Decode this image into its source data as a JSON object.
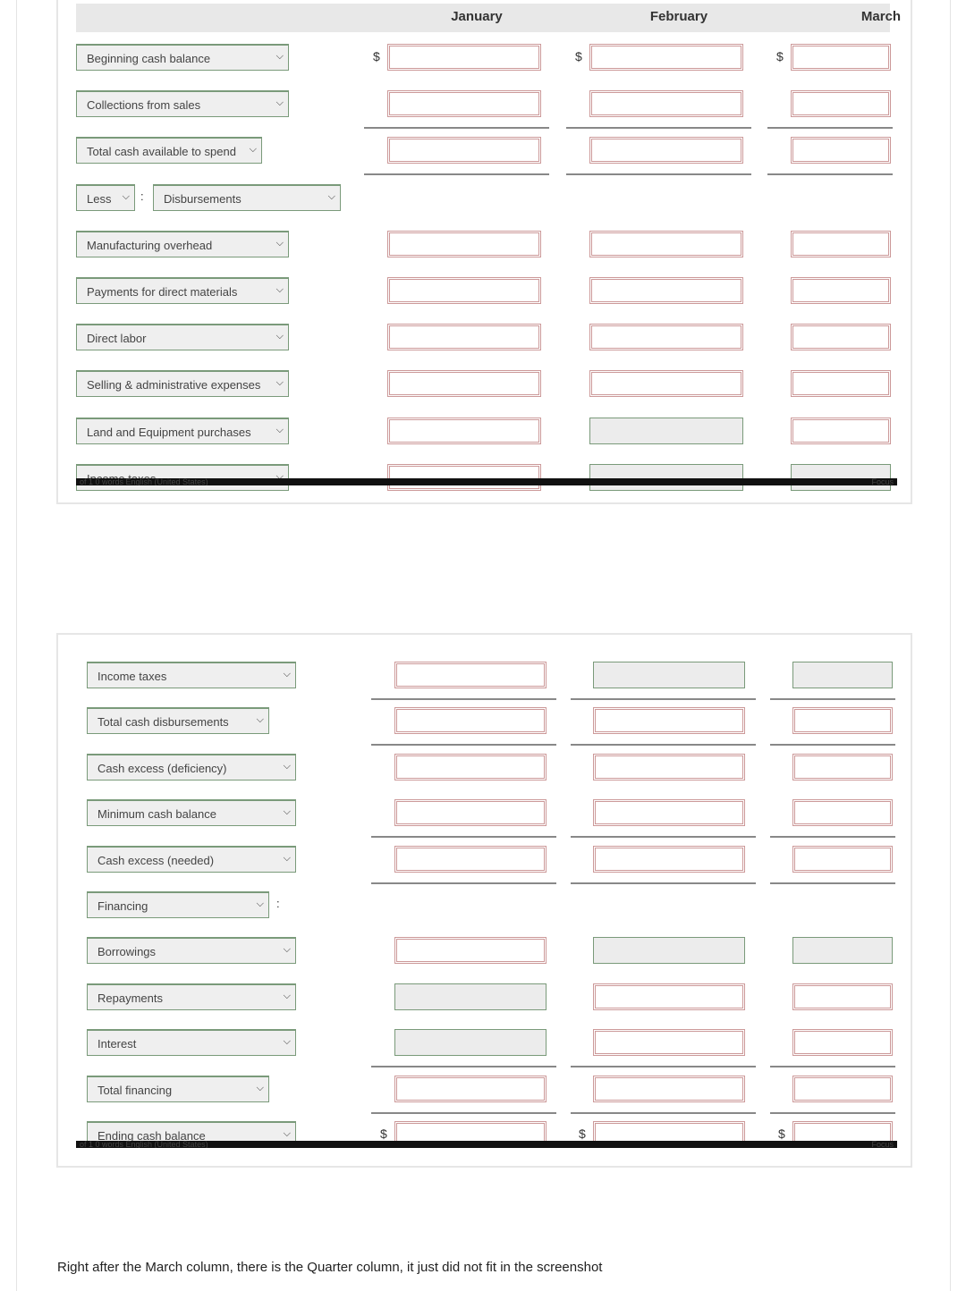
{
  "columns": [
    "January",
    "February",
    "March"
  ],
  "currency_symbol": "$",
  "colon": ":",
  "status_bar": {
    "text": "of 1   0 words   English (United States)",
    "focus": "Focus"
  },
  "panel1": {
    "rows": [
      {
        "label": "Beginning cash balance",
        "cells": [
          "red",
          "red",
          "red"
        ],
        "dollar": true
      },
      {
        "label": "Collections from sales",
        "cells": [
          "red",
          "red",
          "red"
        ],
        "underline": true
      },
      {
        "label": "Total cash available to spend",
        "cells": [
          "red",
          "red",
          "red"
        ],
        "underline": true,
        "narrow": true
      },
      {
        "label": "Less",
        "label2": "Disbursements",
        "cells": []
      },
      {
        "label": "Manufacturing overhead",
        "cells": [
          "red",
          "red",
          "red"
        ]
      },
      {
        "label": "Payments for direct materials",
        "cells": [
          "red",
          "red",
          "red"
        ]
      },
      {
        "label": "Direct labor",
        "cells": [
          "red",
          "red",
          "red"
        ]
      },
      {
        "label": "Selling & administrative expenses",
        "cells": [
          "red",
          "red",
          "red"
        ]
      },
      {
        "label": "Land and Equipment purchases",
        "cells": [
          "red",
          "gray",
          "red"
        ]
      },
      {
        "label": "Income taxes",
        "cells": [
          "red",
          "gray",
          "gray"
        ]
      }
    ]
  },
  "panel2": {
    "rows": [
      {
        "label": "Income taxes",
        "cells": [
          "red",
          "gray",
          "gray"
        ],
        "underline": true
      },
      {
        "label": "Total cash disbursements",
        "cells": [
          "red",
          "red",
          "red"
        ],
        "underline": true,
        "narrow": true
      },
      {
        "label": "Cash excess (deficiency)",
        "cells": [
          "red",
          "red",
          "red"
        ]
      },
      {
        "label": "Minimum cash balance",
        "cells": [
          "red",
          "red",
          "red"
        ],
        "underline": true
      },
      {
        "label": "Cash excess (needed)",
        "cells": [
          "red",
          "red",
          "red"
        ],
        "underline": true
      },
      {
        "label": "Financing",
        "cells": [],
        "colon": true,
        "narrow": true
      },
      {
        "label": "Borrowings",
        "cells": [
          "red",
          "gray",
          "gray"
        ]
      },
      {
        "label": "Repayments",
        "cells": [
          "gray",
          "red",
          "red"
        ]
      },
      {
        "label": "Interest",
        "cells": [
          "gray",
          "red",
          "red"
        ],
        "underline": true
      },
      {
        "label": "Total financing",
        "cells": [
          "red",
          "red",
          "red"
        ],
        "underline": true,
        "narrow": true
      },
      {
        "label": "Ending cash balance",
        "cells": [
          "red",
          "red",
          "red"
        ],
        "dollar": true
      }
    ]
  },
  "note": "Right after the March column, there is the Quarter column, it just did not fit in the screenshot"
}
